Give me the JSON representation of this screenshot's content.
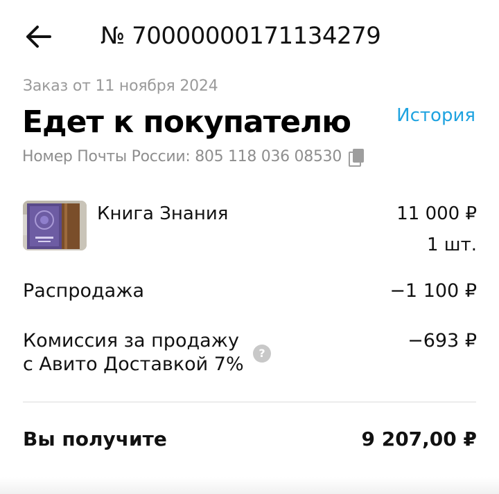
{
  "header": {
    "back_icon": "arrow-left-icon",
    "order_number": "№ 70000000171134279"
  },
  "order": {
    "date_text": "Заказ от 11 ноября 2024",
    "status": "Едет к покупателю",
    "history_link": "История",
    "tracking_text": "Номер Почты России: 805 118 036 08530",
    "copy_icon": "copy-icon"
  },
  "item": {
    "name": "Книга Знания",
    "price": "11 000 ₽",
    "quantity": "1 шт."
  },
  "breakdown": {
    "sale_label": "Распродажа",
    "sale_value": "−1 100 ₽",
    "fee_label_line1": "Комиссия за продажу",
    "fee_label_line2": "с Авито Доставкой 7%",
    "fee_value": "−693 ₽",
    "help_icon": "question-icon"
  },
  "total": {
    "label": "Вы получите",
    "value": "9 207,00 ₽"
  },
  "colors": {
    "accent_link": "#1fa3e0",
    "muted_text": "#9a9a9a",
    "divider": "#ececec"
  }
}
